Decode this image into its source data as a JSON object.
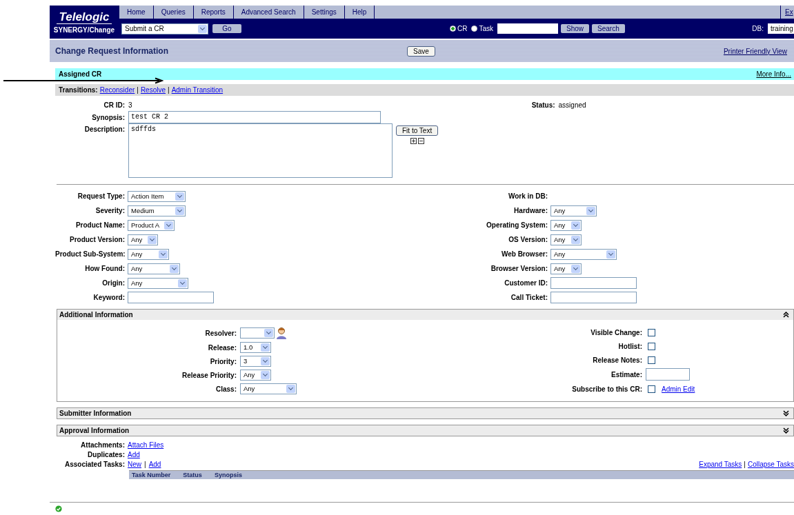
{
  "nav": {
    "logo": "Telelogic",
    "product": "SYNERGY/Change",
    "tabs": [
      {
        "label": "Home",
        "selected": false
      },
      {
        "label": "Queries",
        "selected": false
      },
      {
        "label": "Reports",
        "selected": false
      },
      {
        "label": "Advanced Search",
        "selected": false
      },
      {
        "label": "Settings",
        "selected": false
      },
      {
        "label": "Help",
        "selected": false
      }
    ],
    "exit": "Ex",
    "action_select": "Submit a CR",
    "go": "Go",
    "radios": [
      {
        "label": "CR",
        "selected": true
      },
      {
        "label": "Task",
        "selected": false
      }
    ],
    "show": "Show",
    "search": "Search",
    "db_label": "DB:",
    "db_value": "training"
  },
  "header": {
    "title": "Change Request Information",
    "save": "Save",
    "printer": "Printer Friendly View"
  },
  "state_bar": {
    "title": "Assigned CR",
    "more": "More Info..."
  },
  "transitions": {
    "label": "Transitions:",
    "links": [
      "Reconsider",
      "Resolve",
      "Admin Transition"
    ],
    "separators": [
      "|",
      "|"
    ]
  },
  "summary": {
    "cr_id_label": "CR ID:",
    "cr_id": "3",
    "status_label": "Status:",
    "status": "assigned",
    "synopsis_label": "Synopsis:",
    "synopsis": "test CR 2",
    "description_label": "Description:",
    "description": "sdffds",
    "fit": "Fit to Text"
  },
  "fields_left": [
    {
      "label": "Request Type:",
      "kind": "select",
      "value": "Action Item"
    },
    {
      "label": "Severity:",
      "kind": "select",
      "value": "Medium"
    },
    {
      "label": "Product Name:",
      "kind": "select",
      "value": "Product A"
    },
    {
      "label": "Product Version:",
      "kind": "select",
      "value": "Any"
    },
    {
      "label": "Product Sub-System:",
      "kind": "select",
      "value": "Any"
    },
    {
      "label": "How Found:",
      "kind": "select",
      "value": "Any"
    },
    {
      "label": "Origin:",
      "kind": "select",
      "value": "Any"
    },
    {
      "label": "Keyword:",
      "kind": "text"
    }
  ],
  "fields_right": [
    {
      "label": "Work in DB:",
      "kind": "static"
    },
    {
      "label": "Hardware:",
      "kind": "select",
      "value": "Any"
    },
    {
      "label": "Operating System:",
      "kind": "select",
      "value": "Any"
    },
    {
      "label": "OS Version:",
      "kind": "select",
      "value": "Any"
    },
    {
      "label": "Web Browser:",
      "kind": "select",
      "value": "Any"
    },
    {
      "label": "Browser Version:",
      "kind": "select",
      "value": "Any"
    },
    {
      "label": "Customer ID:",
      "kind": "text"
    },
    {
      "label": "Call Ticket:",
      "kind": "text"
    }
  ],
  "sections": [
    {
      "title": "Additional Information",
      "expanded": true,
      "left": [
        {
          "label": "Resolver:",
          "kind": "person"
        },
        {
          "label": "Release:",
          "kind": "select",
          "value": "1.0"
        },
        {
          "label": "Priority:",
          "kind": "select",
          "value": "3"
        },
        {
          "label": "Release Priority:",
          "kind": "select",
          "value": "Any"
        },
        {
          "label": "Class:",
          "kind": "select",
          "value": "Any"
        }
      ],
      "right": [
        {
          "label": "Visible Change:",
          "kind": "checkbox",
          "checked": false
        },
        {
          "label": "Hotlist:",
          "kind": "checkbox",
          "checked": false
        },
        {
          "label": "Release Notes:",
          "kind": "checkbox",
          "checked": false
        },
        {
          "label": "Estimate:",
          "kind": "text"
        },
        {
          "label": "Subscribe to this CR:",
          "kind": "checkbox",
          "checked": false,
          "link": "Admin Edit"
        }
      ]
    },
    {
      "title": "Submitter Information",
      "expanded": false
    },
    {
      "title": "Approval Information",
      "expanded": false
    }
  ],
  "link_rows": [
    {
      "label": "Attachments:",
      "links": [
        "Attach Files"
      ]
    },
    {
      "label": "Duplicates:",
      "links": [
        "Add"
      ]
    },
    {
      "label": "Associated Tasks:",
      "links": [
        "New",
        "Add"
      ],
      "separators": [
        "|"
      ]
    }
  ],
  "task_links": [
    "Expand Tasks",
    "Collapse Tasks"
  ],
  "task_separators": [
    "|"
  ],
  "task_columns": [
    "Task Number",
    "Status",
    "Synopsis"
  ]
}
